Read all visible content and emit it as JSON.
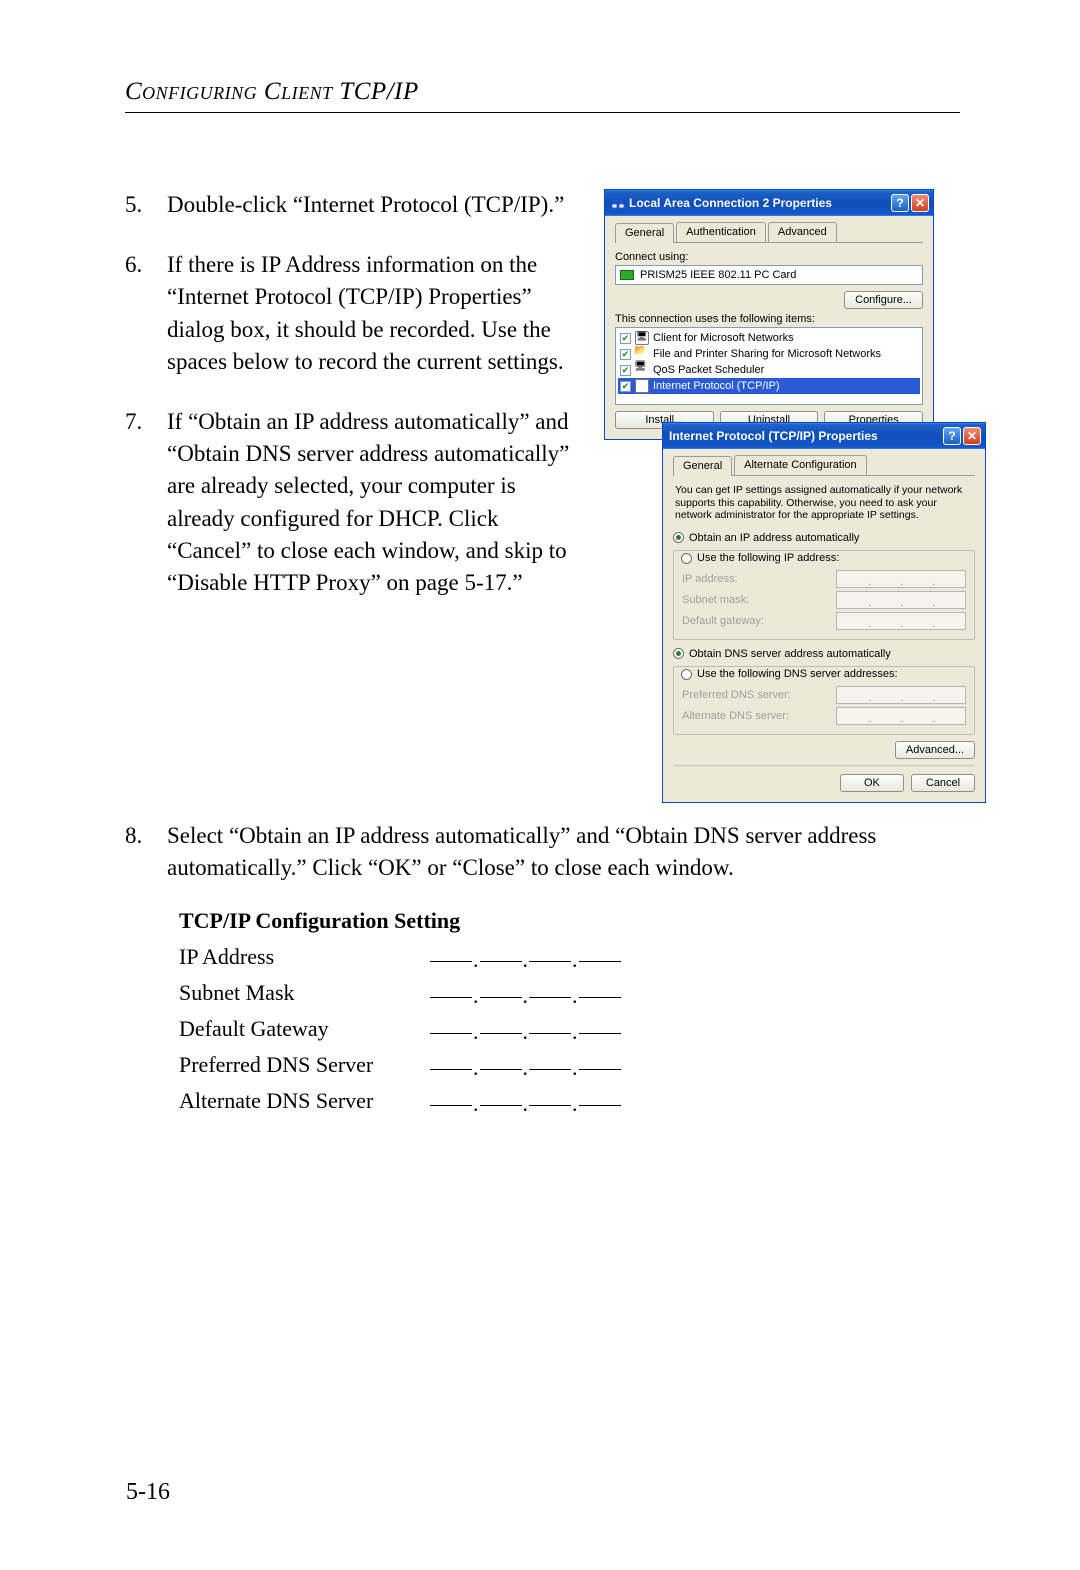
{
  "page": {
    "header": "Configuring Client TCP/IP",
    "footer": "5-16"
  },
  "steps": {
    "s5": {
      "num": "5.",
      "text": "Double-click “Internet Protocol (TCP/IP).”"
    },
    "s6": {
      "num": "6.",
      "text": "If there is IP Address information on the “Internet Protocol (TCP/IP) Properties” dialog box, it should be recorded. Use the spaces below to record the current settings."
    },
    "s7": {
      "num": "7.",
      "text": "If “Obtain an IP address automatically” and “Obtain DNS server address automatically” are already selected, your computer is already configured for DHCP. Click “Cancel” to close each window, and skip to “Disable HTTP Proxy” on page 5-17.”"
    },
    "s8": {
      "num": "8.",
      "text": "Select “Obtain an IP address automatically” and “Obtain DNS server address automatically.” Click “OK” or “Close” to close each window."
    }
  },
  "config": {
    "heading": "TCP/IP Configuration Setting",
    "rows": {
      "ip": "IP Address",
      "subnet": "Subnet Mask",
      "gateway": "Default Gateway",
      "pdns": "Preferred DNS Server",
      "adns": "Alternate DNS Server"
    }
  },
  "dialog1": {
    "title": "Local Area Connection 2 Properties",
    "tabs": {
      "general": "General",
      "auth": "Authentication",
      "adv": "Advanced"
    },
    "connect_label": "Connect using:",
    "adapter": "PRISM25 IEEE 802.11 PC Card",
    "configure": "Configure...",
    "items_label": "This connection uses the following items:",
    "items": {
      "a": "Client for Microsoft Networks",
      "b": "File and Printer Sharing for Microsoft Networks",
      "c": "QoS Packet Scheduler",
      "d": "Internet Protocol (TCP/IP)"
    },
    "buttons": {
      "install": "Install...",
      "uninstall": "Uninstall",
      "properties": "Properties"
    }
  },
  "dialog2": {
    "title": "Internet Protocol (TCP/IP) Properties",
    "tabs": {
      "general": "General",
      "alt": "Alternate Configuration"
    },
    "desc": "You can get IP settings assigned automatically if your network supports this capability. Otherwise, you need to ask your network administrator for the appropriate IP settings.",
    "radios": {
      "obtain_ip": "Obtain an IP address automatically",
      "use_ip": "Use the following IP address:",
      "obtain_dns": "Obtain DNS server address automatically",
      "use_dns": "Use the following DNS server addresses:"
    },
    "fields": {
      "ip": "IP address:",
      "subnet": "Subnet mask:",
      "gateway": "Default gateway:",
      "pdns": "Preferred DNS server:",
      "adns": "Alternate DNS server:"
    },
    "advanced": "Advanced...",
    "ok": "OK",
    "cancel": "Cancel"
  }
}
